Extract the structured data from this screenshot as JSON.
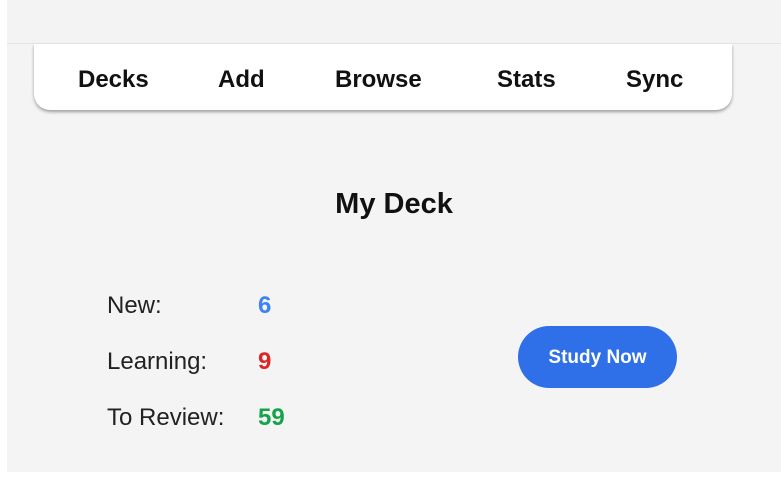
{
  "toolbar": {
    "items": [
      {
        "label": "Decks"
      },
      {
        "label": "Add"
      },
      {
        "label": "Browse"
      },
      {
        "label": "Stats"
      },
      {
        "label": "Sync"
      }
    ]
  },
  "deck": {
    "title": "My Deck",
    "stats": {
      "new_label": "New:",
      "new_value": "6",
      "learning_label": "Learning:",
      "learning_value": "9",
      "review_label": "To Review:",
      "review_value": "59"
    },
    "study_button_label": "Study Now"
  },
  "colors": {
    "new": "#3b82f6",
    "learning": "#dc2626",
    "review": "#16a34a",
    "accent": "#2f6fe8"
  }
}
